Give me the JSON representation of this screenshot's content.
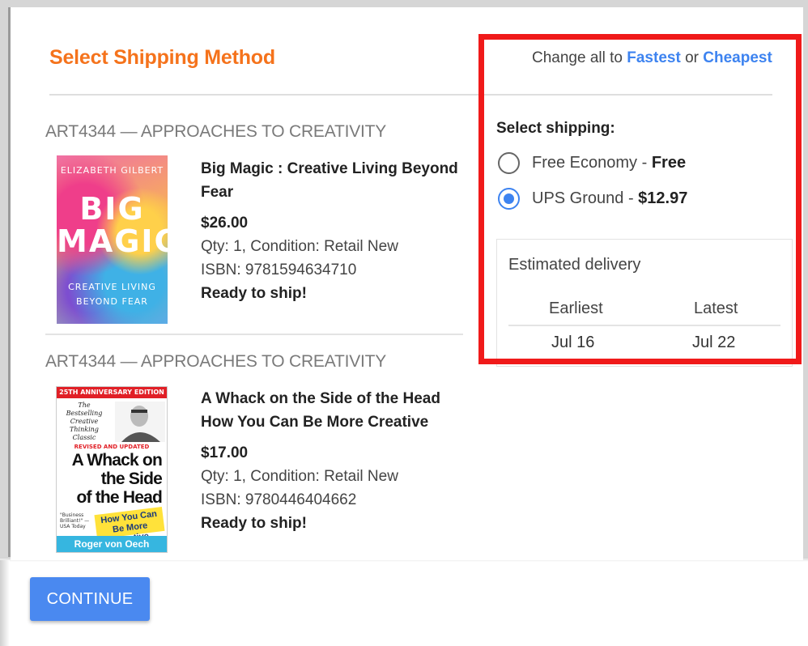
{
  "header": {
    "title": "Select Shipping Method",
    "change_all_prefix": "Change all to",
    "fastest_link": "Fastest",
    "or_text": "or",
    "cheapest_link": "Cheapest"
  },
  "books": [
    {
      "course": "ART4344 — APPROACHES TO CREATIVITY",
      "title_line1": "Big Magic : Creative Living Beyond",
      "title_line2": "Fear",
      "price": "$26.00",
      "qty_condition": "Qty: 1, Condition: Retail New",
      "isbn": "ISBN: 9781594634710",
      "status": "Ready to ship!",
      "cover": {
        "author": "ELIZABETH GILBERT",
        "title_line1": "BIG",
        "title_line2": "MAGIC",
        "subtitle_line1": "CREATIVE LIVING",
        "subtitle_line2": "BEYOND FEAR"
      }
    },
    {
      "course": "ART4344 — APPROACHES TO CREATIVITY",
      "title_line1": "A Whack on the Side of the Head",
      "title_line2": "How You Can Be More Creative",
      "price": "$17.00",
      "qty_condition": "Qty: 1, Condition: Retail New",
      "isbn": "ISBN: 9780446404662",
      "status": "Ready to ship!",
      "cover": {
        "banner": "25TH ANNIVERSARY EDITION",
        "tagline": "The Bestselling Creative Thinking Classic",
        "revised": "REVISED AND UPDATED",
        "title_line1": "A Whack on",
        "title_line2": "the Side",
        "title_line3": "of the Head",
        "quote": "\"Business Brilliant!\" —USA Today",
        "sticker": "How You Can Be More Creative",
        "author": "Roger von Oech"
      }
    }
  ],
  "shipping": {
    "label": "Select shipping:",
    "options": [
      {
        "name": "Free Economy",
        "separator": " - ",
        "price": "Free",
        "selected": false
      },
      {
        "name": "UPS Ground",
        "separator": " - ",
        "price": "$12.97",
        "selected": true
      }
    ]
  },
  "delivery": {
    "title": "Estimated delivery",
    "earliest_label": "Earliest",
    "latest_label": "Latest",
    "earliest_value": "Jul 16",
    "latest_value": "Jul 22"
  },
  "actions": {
    "continue_label": "CONTINUE"
  },
  "colors": {
    "title_orange": "#f5731c",
    "link_blue": "#3d83f0",
    "highlight_red": "#f01a1a",
    "button_blue": "#4a89f0"
  }
}
